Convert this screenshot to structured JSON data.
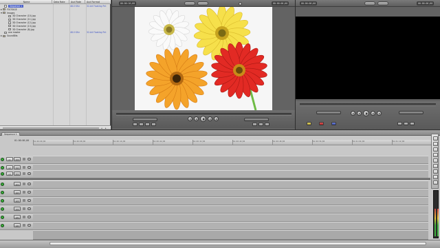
{
  "browser": {
    "columns": [
      "Name",
      "Data Rate",
      "Aud Rate",
      "Aud Format"
    ],
    "items": [
      {
        "name": "Sequence 1",
        "data_rate": "",
        "aud_rate": "",
        "aud_format": "",
        "type": "sequence",
        "selected": true,
        "indent": 1
      },
      {
        "name": "FOOTAGE",
        "data_rate": "",
        "aud_rate": "",
        "aud_format": "",
        "type": "bin",
        "indent": 0,
        "expanded": false
      },
      {
        "name": "Images",
        "data_rate": "",
        "aud_rate": "",
        "aud_format": "",
        "type": "bin",
        "indent": 0,
        "expanded": true
      },
      {
        "name": "3D Character (10).jpg",
        "data_rate": "",
        "aud_rate": "",
        "aud_format": "",
        "type": "clip",
        "indent": 2
      },
      {
        "name": "3D Character (11).jpg",
        "data_rate": "",
        "aud_rate": "",
        "aud_format": "",
        "type": "clip",
        "indent": 2
      },
      {
        "name": "3D Character (12).jpg",
        "data_rate": "",
        "aud_rate": "",
        "aud_format": "",
        "type": "clip",
        "indent": 2
      },
      {
        "name": "3D Character (13).jpg",
        "data_rate": "",
        "aud_rate": "",
        "aud_format": "",
        "type": "clip",
        "indent": 2
      },
      {
        "name": "3D Character (8).jpg",
        "data_rate": "",
        "aud_rate": "",
        "aud_format": "",
        "type": "clip",
        "indent": 2
      },
      {
        "name": "one master",
        "data_rate": "",
        "aud_rate": "48.0 KHz",
        "aud_format": "32-bit Floating Pnt",
        "type": "clip",
        "indent": 1
      },
      {
        "name": "SoundBits",
        "data_rate": "",
        "aud_rate": "",
        "aud_format": "",
        "type": "bin",
        "indent": 0,
        "expanded": false
      }
    ],
    "first_row_aud_rate": "48.0 KHz",
    "first_row_aud_format": "32-bit Floating Pnt"
  },
  "viewer": {
    "timecode_left": "00:00:10;00",
    "timecode_right": "00:00:00;00",
    "flowers": [
      "white gerbera",
      "yellow gerbera",
      "orange gerbera",
      "red gerbera"
    ]
  },
  "canvas": {
    "timecode_left": "00:00:00;00",
    "timecode_right": "00:00:00;00"
  },
  "timeline": {
    "tab_label": "Sequence 1",
    "current_timecode": "01:00:00;00",
    "ruler_labels": [
      "01:00:00;00",
      "01:00:08;00",
      "01:00:16;00",
      "01:00:24;00",
      "01:00:32;00",
      "01:00:40;00",
      "01:00:48;00",
      "01:00:56;00",
      "01:01:04;00",
      "01:01:12;00"
    ],
    "video_tracks": [
      {
        "dest": "v1",
        "src": "V3"
      },
      {
        "dest": "v2",
        "src": "V2"
      },
      {
        "dest": "v3",
        "src": "V1"
      }
    ],
    "audio_tracks": [
      {
        "src": "A1"
      },
      {
        "src": "A2"
      },
      {
        "src": "A3"
      },
      {
        "src": "A4"
      },
      {
        "src": "A5"
      },
      {
        "src": "A6"
      }
    ]
  },
  "colors": {
    "selection": "#4c62c9",
    "track_enabled": "#2fb52f",
    "canvas_black": "#000000"
  }
}
